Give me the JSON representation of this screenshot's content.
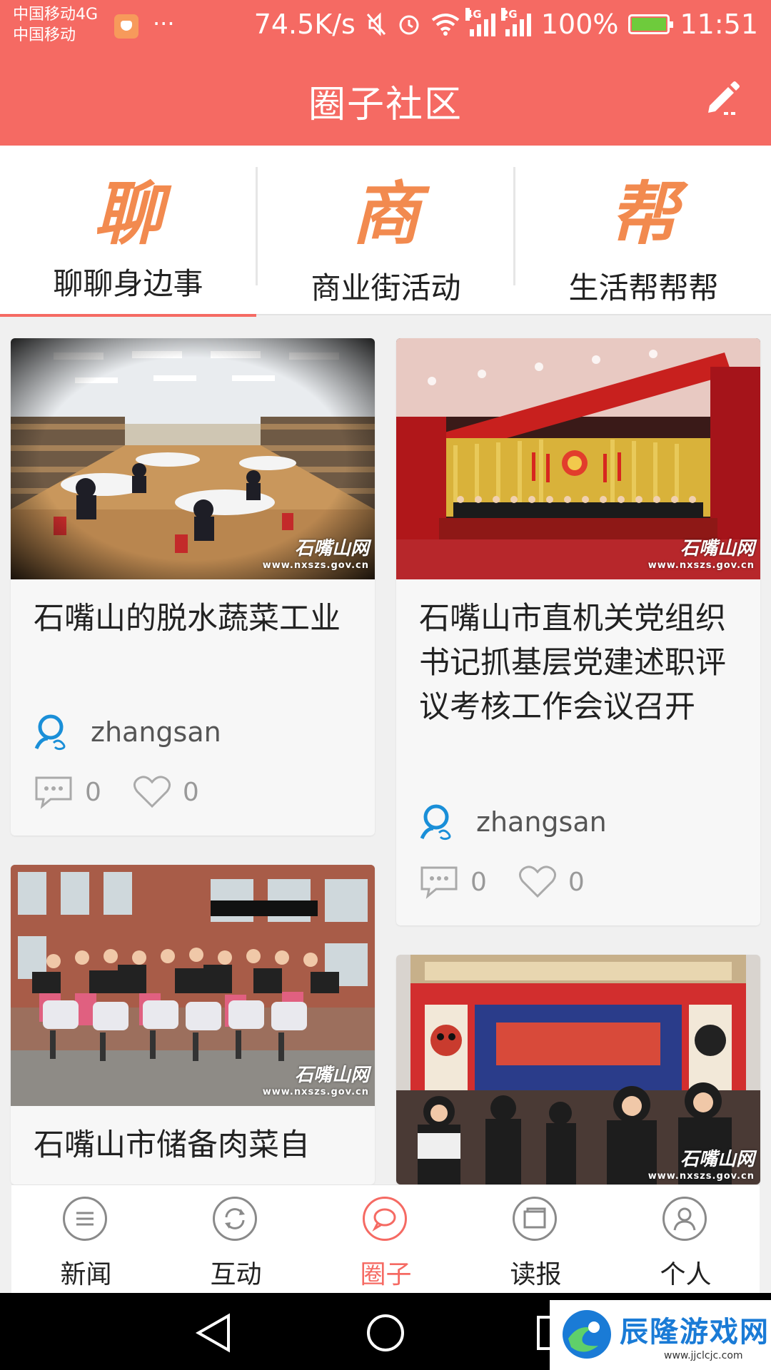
{
  "status_bar": {
    "carrier_line1": "中国移动4G",
    "carrier_line2": "中国移动",
    "dots": "···",
    "net_speed": "74.5K/s",
    "sim1_tag": "4G",
    "sim2_tag": "2G",
    "battery_pct": "100%",
    "time": "11:51"
  },
  "header": {
    "title": "圈子社区",
    "edit_icon": "pencil-icon"
  },
  "tabs": [
    {
      "glyph": "聊",
      "label": "聊聊身边事",
      "active": true
    },
    {
      "glyph": "商",
      "label": "商业街活动",
      "active": false
    },
    {
      "glyph": "帮",
      "label": "生活帮帮帮",
      "active": false
    }
  ],
  "posts": [
    {
      "title": "石嘴山的脱水蔬菜工业",
      "author": "zhangsan",
      "comments": "0",
      "likes": "0",
      "image_watermark": "石嘴山网",
      "image_url_text": "www.nxszs.gov.cn"
    },
    {
      "title": "石嘴山市直机关党组织书记抓基层党建述职评议考核工作会议召开",
      "author": "zhangsan",
      "comments": "0",
      "likes": "0",
      "image_watermark": "石嘴山网",
      "image_url_text": "www.nxszs.gov.cn"
    },
    {
      "title": "石嘴山市储备肉菜自",
      "image_watermark": "石嘴山网",
      "image_url_text": "www.nxszs.gov.cn"
    },
    {
      "image_watermark": "石嘴山网",
      "image_url_text": "www.nxszs.gov.cn"
    }
  ],
  "bottom_nav": [
    {
      "label": "新闻",
      "icon": "menu-circle-icon",
      "active": false
    },
    {
      "label": "互动",
      "icon": "refresh-circle-icon",
      "active": false
    },
    {
      "label": "圈子",
      "icon": "chat-bubble-icon",
      "active": true
    },
    {
      "label": "读报",
      "icon": "newspaper-icon",
      "active": false
    },
    {
      "label": "个人",
      "icon": "user-icon",
      "active": false
    }
  ],
  "overlay_watermark": {
    "text": "辰隆游戏网",
    "url": "www.jjclcjc.com"
  },
  "colors": {
    "accent": "#f56a63",
    "tab_glyph": "#f28a4f"
  }
}
